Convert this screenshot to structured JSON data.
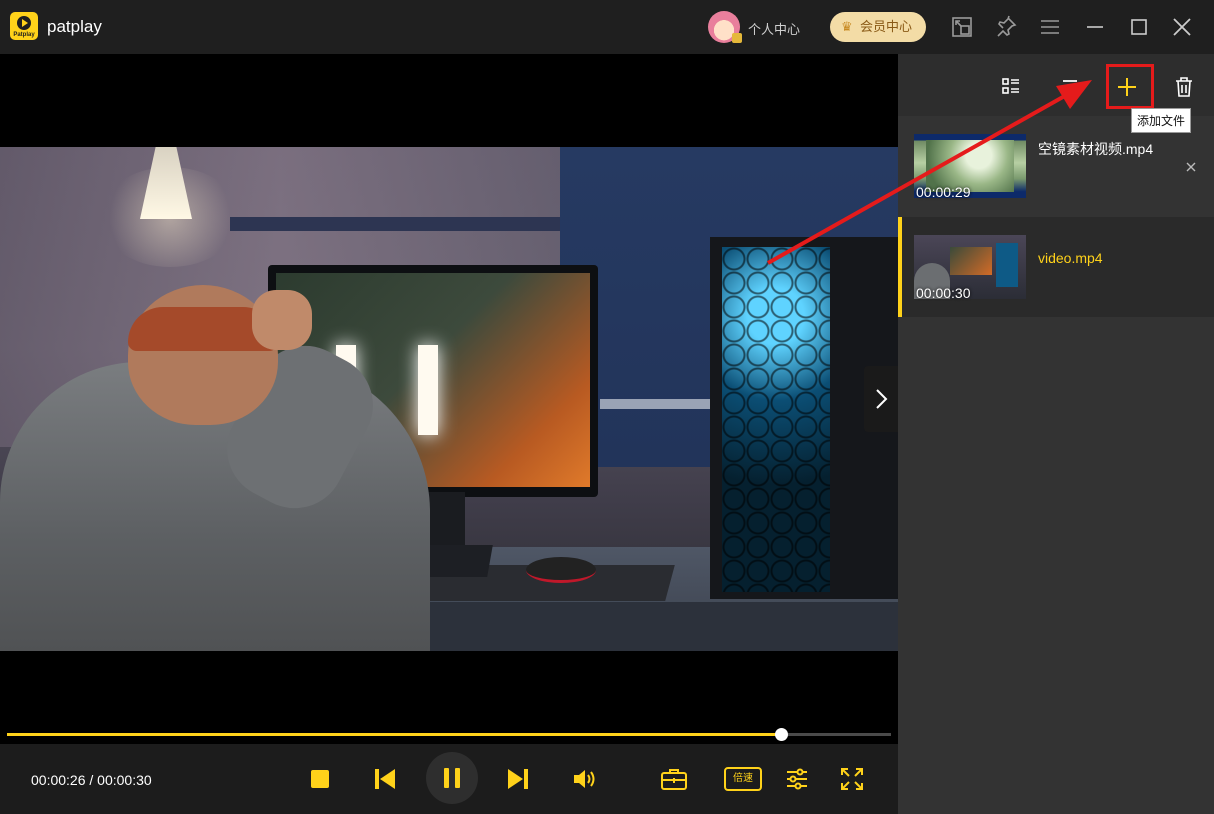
{
  "app": {
    "name": "patplay",
    "logo_text": "Patplay"
  },
  "header": {
    "user_center_label": "个人中心",
    "vip_label": "会员中心",
    "icons": [
      "mini-mode-icon",
      "pin-icon",
      "menu-icon",
      "minimize-icon",
      "maximize-icon",
      "close-icon"
    ]
  },
  "player": {
    "current_time": "00:00:26",
    "duration": "00:00:30",
    "time_display": "00:00:26 / 00:00:30",
    "progress": 0.876,
    "speed_label": "倍速",
    "accent": "#ffd21a"
  },
  "sidebar": {
    "toolbar": {
      "icons": [
        "list-view-icon",
        "sort-icon",
        "add-file-icon",
        "delete-icon"
      ],
      "add_tooltip": "添加文件"
    },
    "playlist": [
      {
        "name": "空镜素材视频.mp4",
        "duration": "00:00:29",
        "active": false
      },
      {
        "name": "video.mp4",
        "duration": "00:00:30",
        "active": true
      }
    ]
  },
  "annotation": {
    "color": "#e51b1b"
  }
}
